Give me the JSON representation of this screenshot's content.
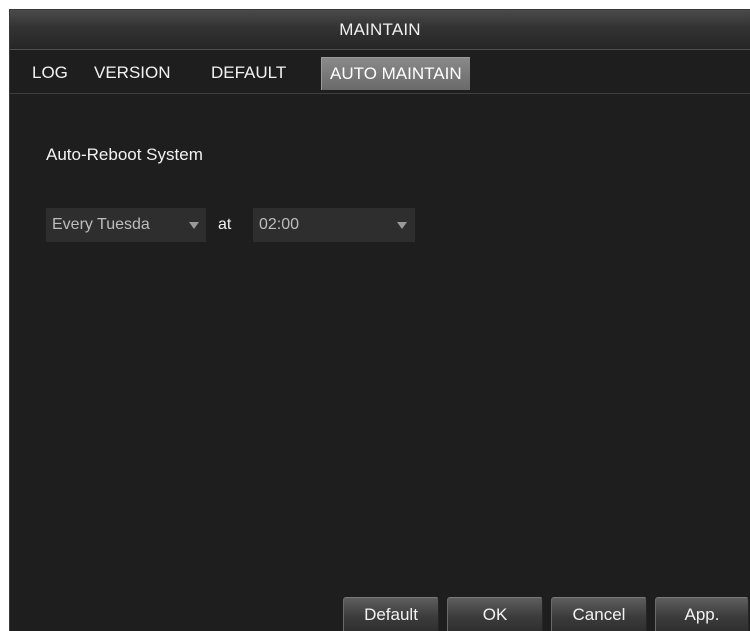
{
  "window": {
    "title": "MAINTAIN"
  },
  "tabs": [
    {
      "label": "LOG",
      "active": false
    },
    {
      "label": "VERSION",
      "active": false
    },
    {
      "label": "DEFAULT",
      "active": false
    },
    {
      "label": "AUTO MAINTAIN",
      "active": true
    }
  ],
  "auto_reboot": {
    "label": "Auto-Reboot System",
    "day_value": "Every Tuesda",
    "at_label": "at",
    "time_value": "02:00"
  },
  "buttons": {
    "default": "Default",
    "ok": "OK",
    "cancel": "Cancel",
    "apply": "App."
  },
  "icons": {
    "dropdown": "chevron-down-icon"
  }
}
